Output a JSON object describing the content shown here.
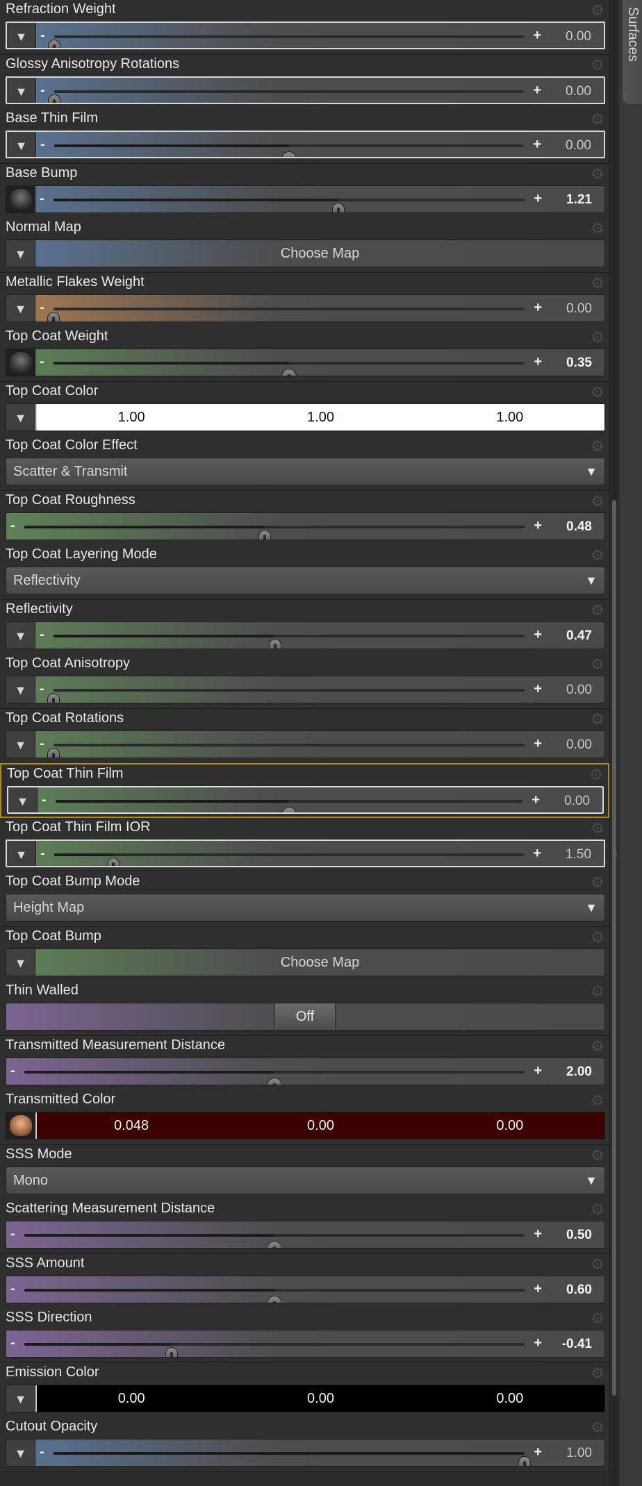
{
  "side_tab": {
    "label": "Surfaces"
  },
  "properties": [
    {
      "id": "refraction-weight",
      "label": "Refraction Weight",
      "kind": "slider",
      "button": "dropdown",
      "value": "0.00",
      "tint": "blue",
      "position_fraction": 0.0,
      "outlined": true
    },
    {
      "id": "glossy-anisotropy-rotations",
      "label": "Glossy Anisotropy Rotations",
      "kind": "slider",
      "button": "dropdown",
      "value": "0.00",
      "tint": "blue",
      "position_fraction": 0.0,
      "outlined": true
    },
    {
      "id": "base-thin-film",
      "label": "Base Thin Film",
      "kind": "slider",
      "button": "dropdown",
      "value": "0.00",
      "tint": "blue",
      "position_fraction": 0.5,
      "round_knob": true,
      "outlined": true
    },
    {
      "id": "base-bump",
      "label": "Base Bump",
      "kind": "slider",
      "button": "thumbnail",
      "value": "1.21",
      "tint": "blue",
      "position_fraction": 0.605,
      "bright": true
    },
    {
      "id": "normal-map",
      "label": "Normal Map",
      "kind": "choose",
      "button": "dropdown",
      "value": "Choose Map",
      "tint": "blue"
    },
    {
      "id": "metallic-flakes-weight",
      "label": "Metallic Flakes Weight",
      "kind": "slider",
      "button": "dropdown",
      "value": "0.00",
      "tint": "orange",
      "position_fraction": 0.0
    },
    {
      "id": "top-coat-weight",
      "label": "Top Coat Weight",
      "kind": "slider",
      "button": "thumbnail",
      "value": "0.35",
      "tint": "green",
      "position_fraction": 0.5,
      "round_knob": true,
      "bright": true
    },
    {
      "id": "top-coat-color",
      "label": "Top Coat Color",
      "kind": "color",
      "button": "dropdown",
      "fields": [
        "1.00",
        "1.00",
        "1.00"
      ],
      "bg": "#ffffff",
      "fg": "#111111"
    },
    {
      "id": "top-coat-color-effect",
      "label": "Top Coat Color Effect",
      "kind": "dropdown",
      "value": "Scatter & Transmit"
    },
    {
      "id": "top-coat-roughness",
      "label": "Top Coat Roughness",
      "kind": "slider",
      "button": "none",
      "value": "0.48",
      "tint": "green",
      "position_fraction": 0.48,
      "bright": true
    },
    {
      "id": "top-coat-layering-mode",
      "label": "Top Coat Layering Mode",
      "kind": "dropdown",
      "value": "Reflectivity"
    },
    {
      "id": "reflectivity",
      "label": "Reflectivity",
      "kind": "slider",
      "button": "dropdown",
      "value": "0.47",
      "tint": "green",
      "position_fraction": 0.47,
      "bright": true
    },
    {
      "id": "top-coat-anisotropy",
      "label": "Top Coat Anisotropy",
      "kind": "slider",
      "button": "dropdown",
      "value": "0.00",
      "tint": "green",
      "position_fraction": 0.0
    },
    {
      "id": "top-coat-rotations",
      "label": "Top Coat Rotations",
      "kind": "slider",
      "button": "dropdown",
      "value": "0.00",
      "tint": "green",
      "position_fraction": 0.0
    },
    {
      "id": "top-coat-thin-film",
      "label": "Top Coat Thin Film",
      "kind": "slider",
      "button": "dropdown",
      "value": "0.00",
      "tint": "green",
      "position_fraction": 0.5,
      "round_knob": true,
      "selected": true,
      "outlined": true
    },
    {
      "id": "top-coat-thin-film-ior",
      "label": "Top Coat Thin Film IOR",
      "kind": "slider",
      "button": "dropdown",
      "value": "1.50",
      "tint": "green",
      "position_fraction": 0.125,
      "outlined": true
    },
    {
      "id": "top-coat-bump-mode",
      "label": "Top Coat Bump Mode",
      "kind": "dropdown",
      "value": "Height Map"
    },
    {
      "id": "top-coat-bump",
      "label": "Top Coat Bump",
      "kind": "choose",
      "button": "dropdown",
      "value": "Choose Map",
      "tint": "green"
    },
    {
      "id": "thin-walled",
      "label": "Thin Walled",
      "kind": "toggle",
      "value": "Off",
      "tint": "purple"
    },
    {
      "id": "transmitted-measurement-distance",
      "label": "Transmitted Measurement Distance",
      "kind": "slider",
      "button": "none",
      "value": "2.00",
      "tint": "purple",
      "position_fraction": 0.5,
      "round_knob": true,
      "bright": true
    },
    {
      "id": "transmitted-color",
      "label": "Transmitted Color",
      "kind": "color",
      "button": "thumbnail-warm",
      "fields": [
        "0.048",
        "0.00",
        "0.00"
      ],
      "bg": "#3c0000",
      "fg": "#f4f4f4"
    },
    {
      "id": "sss-mode",
      "label": "SSS Mode",
      "kind": "dropdown",
      "value": "Mono"
    },
    {
      "id": "scattering-measurement-distance",
      "label": "Scattering Measurement Distance",
      "kind": "slider",
      "button": "none",
      "value": "0.50",
      "tint": "purple",
      "position_fraction": 0.5,
      "round_knob": true,
      "bright": true
    },
    {
      "id": "sss-amount",
      "label": "SSS Amount",
      "kind": "slider",
      "button": "none",
      "value": "0.60",
      "tint": "purple",
      "position_fraction": 0.5,
      "round_knob": true,
      "bright": true
    },
    {
      "id": "sss-direction",
      "label": "SSS Direction",
      "kind": "slider",
      "button": "none",
      "value": "-0.41",
      "tint": "purple",
      "position_fraction": 0.295,
      "bright": true
    },
    {
      "id": "emission-color",
      "label": "Emission Color",
      "kind": "color",
      "button": "dropdown",
      "fields": [
        "0.00",
        "0.00",
        "0.00"
      ],
      "bg": "#000000",
      "fg": "#f4f4f4"
    },
    {
      "id": "cutout-opacity",
      "label": "Cutout Opacity",
      "kind": "slider",
      "button": "dropdown",
      "value": "1.00",
      "tint": "blue",
      "position_fraction": 1.0,
      "partial": true
    }
  ],
  "tints": {
    "blue": "#5a7596",
    "orange": "#a87c52",
    "green": "#5e8257",
    "purple": "#7b6592"
  },
  "icons": {
    "dropdown": "triangle-down-icon",
    "gear": "gear-icon",
    "minus": "minus-icon",
    "plus": "plus-icon"
  }
}
